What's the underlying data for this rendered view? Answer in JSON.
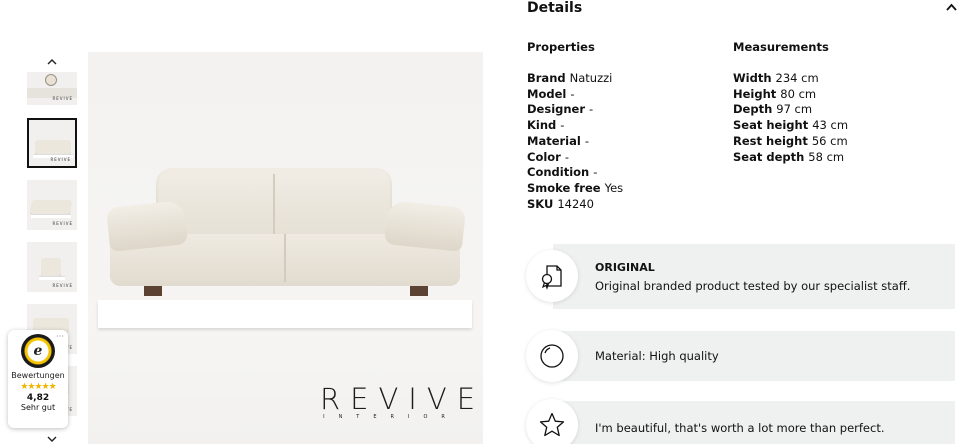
{
  "gallery": {
    "up_icon": "chevron-up-icon",
    "down_icon": "chevron-down-icon",
    "thumbnails": [
      {
        "label": "REVIVE"
      },
      {
        "label": "REVIVE"
      },
      {
        "label": "REVIVE"
      },
      {
        "label": "REVIVE"
      },
      {
        "label": "REVIVE"
      },
      {
        "label": "REVIVE"
      }
    ],
    "main_brand": "REVIVE",
    "main_brand_sub": "INTERIOR"
  },
  "trust_badge": {
    "seal_letter": "e",
    "label": "Bewertungen",
    "stars": "★★★★★",
    "score": "4,82",
    "rating_text": "Sehr gut",
    "menu": "···"
  },
  "details": {
    "title": "Details",
    "toggle_icon": "chevron-up-icon",
    "properties_heading": "Properties",
    "measurements_heading": "Measurements",
    "properties": [
      {
        "key": "Brand",
        "value": "Natuzzi"
      },
      {
        "key": "Model",
        "value": "-"
      },
      {
        "key": "Designer",
        "value": "-"
      },
      {
        "key": "Kind",
        "value": "-"
      },
      {
        "key": "Material",
        "value": "-"
      },
      {
        "key": "Color",
        "value": "-"
      },
      {
        "key": "Condition",
        "value": "-"
      },
      {
        "key": "Smoke free",
        "value": "Yes"
      },
      {
        "key": "SKU",
        "value": "14240"
      }
    ],
    "measurements": [
      {
        "key": "Width",
        "value": "234 cm"
      },
      {
        "key": "Height",
        "value": "80 cm"
      },
      {
        "key": "Depth",
        "value": "97 cm"
      },
      {
        "key": "Seat height",
        "value": "43 cm"
      },
      {
        "key": "Rest height",
        "value": "56 cm"
      },
      {
        "key": "Seat depth",
        "value": "58 cm"
      }
    ]
  },
  "features": [
    {
      "icon": "certificate-icon",
      "title": "ORIGINAL",
      "text": "Original branded product tested by our specialist staff."
    },
    {
      "icon": "quality-circle-icon",
      "text": "Material: High quality"
    },
    {
      "icon": "star-icon",
      "text": "I'm beautiful, that's worth a lot more than perfect."
    }
  ],
  "colors": {
    "feature_bg": "#eff1f0",
    "accent_star": "#f0b400"
  }
}
